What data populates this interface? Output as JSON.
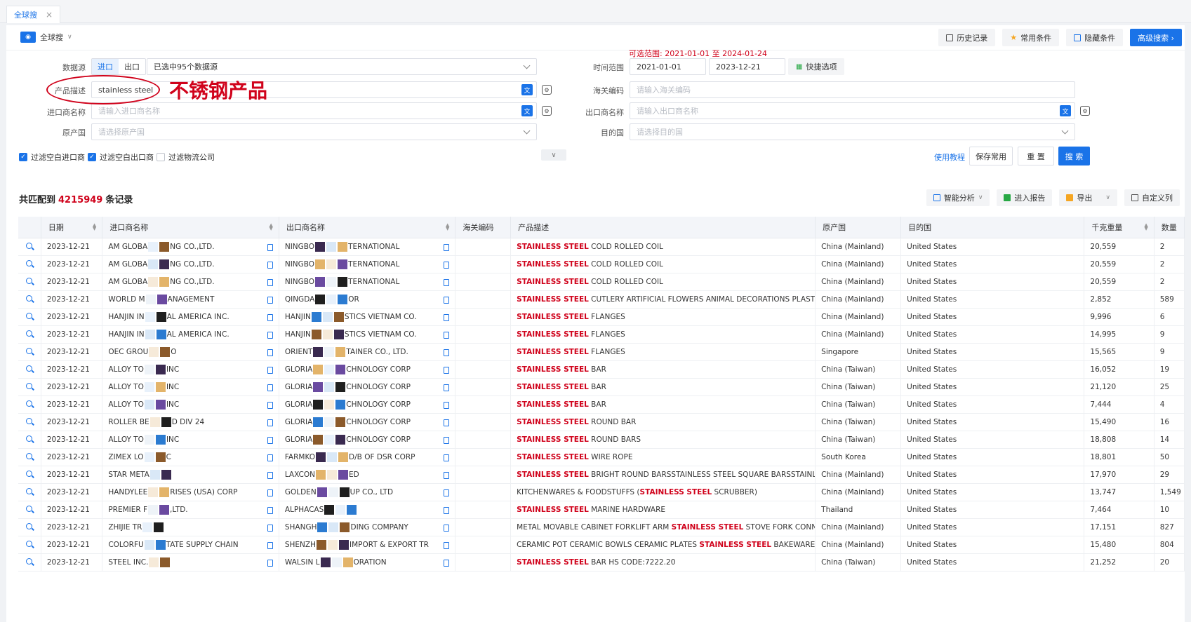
{
  "tab": {
    "label": "全球搜",
    "close": "×"
  },
  "header": {
    "mode_label": "全球搜",
    "buttons": [
      "历史记录",
      "常用条件",
      "隐藏条件",
      "高级搜索 ›"
    ]
  },
  "form": {
    "data_source_label": "数据源",
    "import_label": "进口",
    "export_label": "出口",
    "data_source_value": "已选中95个数据源",
    "product_label": "产品描述",
    "product_value": "stainless steel",
    "importer_label": "进口商名称",
    "importer_placeholder": "请输入进口商名称",
    "origin_label": "原产国",
    "origin_placeholder": "请选择原产国",
    "range_hint": "可选范围: 2021-01-01 至 2024-01-24",
    "time_label": "时间范围",
    "date_start": "2021-01-01",
    "date_end": "2023-12-21",
    "quick_label": "快捷选项",
    "hs_label": "海关编码",
    "hs_placeholder": "请输入海关编码",
    "exporter_label": "出口商名称",
    "exporter_placeholder": "请输入出口商名称",
    "dest_label": "目的国",
    "dest_placeholder": "请选择目的国",
    "filter_importer": "过滤空白进口商",
    "filter_exporter": "过滤空白出口商",
    "filter_logistics": "过滤物流公司",
    "tutorial_link": "使用教程",
    "save_common": "保存常用",
    "reset": "重 置",
    "search": "搜 索"
  },
  "annotation": "不锈钢产品",
  "results": {
    "count_prefix": "共匹配到",
    "count": "4215949",
    "count_suffix": "条记录",
    "tools": [
      "智能分析",
      "进入报告",
      "导出",
      "自定义列"
    ],
    "columns": [
      "日期",
      "进口商名称",
      "出口商名称",
      "海关编码",
      "产品描述",
      "原产国",
      "目的国",
      "千克重量",
      "数量"
    ],
    "rows": [
      {
        "date": "2023-12-21",
        "importer_a": "AM GLOBA",
        "importer_b": "NG CO.,LTD.",
        "exporter_a": "NINGBO",
        "exporter_b": "TERNATIONAL",
        "hl_pre": "",
        "hl": "STAINLESS STEEL",
        "desc": " COLD ROLLED COIL",
        "origin": "China (Mainland)",
        "dest": "United States",
        "kg": "20,559",
        "qty": "2"
      },
      {
        "date": "2023-12-21",
        "importer_a": "AM GLOBA",
        "importer_b": "NG CO.,LTD.",
        "exporter_a": "NINGBO",
        "exporter_b": "TERNATIONAL",
        "hl_pre": "",
        "hl": "STAINLESS STEEL",
        "desc": " COLD ROLLED COIL",
        "origin": "China (Mainland)",
        "dest": "United States",
        "kg": "20,559",
        "qty": "2"
      },
      {
        "date": "2023-12-21",
        "importer_a": "AM GLOBA",
        "importer_b": "NG CO.,LTD.",
        "exporter_a": "NINGBO",
        "exporter_b": "TERNATIONAL",
        "hl_pre": "",
        "hl": "STAINLESS STEEL",
        "desc": " COLD ROLLED COIL",
        "origin": "China (Mainland)",
        "dest": "United States",
        "kg": "20,559",
        "qty": "2"
      },
      {
        "date": "2023-12-21",
        "importer_a": "WORLD M",
        "importer_b": "ANAGEMENT",
        "exporter_a": "QINGDA",
        "exporter_b": "OR",
        "hl_pre": "",
        "hl": "STAINLESS STEEL",
        "desc": " CUTLERY ARTIFICIAL FLOWERS ANIMAL DECORATIONS PLASTIC",
        "origin": "China (Mainland)",
        "dest": "United States",
        "kg": "2,852",
        "qty": "589"
      },
      {
        "date": "2023-12-21",
        "importer_a": "HANJIN IN",
        "importer_b": "AL AMERICA INC.",
        "exporter_a": "HANJIN",
        "exporter_b": "STICS VIETNAM CO.",
        "hl_pre": "",
        "hl": "STAINLESS STEEL",
        "desc": " FLANGES",
        "origin": "China (Mainland)",
        "dest": "United States",
        "kg": "9,996",
        "qty": "6"
      },
      {
        "date": "2023-12-21",
        "importer_a": "HANJIN IN",
        "importer_b": "AL AMERICA INC.",
        "exporter_a": "HANJIN",
        "exporter_b": "STICS VIETNAM CO.",
        "hl_pre": "",
        "hl": "STAINLESS STEEL",
        "desc": " FLANGES",
        "origin": "China (Mainland)",
        "dest": "United States",
        "kg": "14,995",
        "qty": "9"
      },
      {
        "date": "2023-12-21",
        "importer_a": "OEC GROU",
        "importer_b": "O",
        "exporter_a": "ORIENT",
        "exporter_b": "TAINER CO., LTD.",
        "hl_pre": "",
        "hl": "STAINLESS STEEL",
        "desc": " FLANGES",
        "origin": "Singapore",
        "dest": "United States",
        "kg": "15,565",
        "qty": "9"
      },
      {
        "date": "2023-12-21",
        "importer_a": "ALLOY TO",
        "importer_b": "INC",
        "exporter_a": "GLORIA",
        "exporter_b": "CHNOLOGY CORP",
        "hl_pre": "",
        "hl": "STAINLESS STEEL",
        "desc": " BAR",
        "origin": "China (Taiwan)",
        "dest": "United States",
        "kg": "16,052",
        "qty": "19"
      },
      {
        "date": "2023-12-21",
        "importer_a": "ALLOY TO",
        "importer_b": "INC",
        "exporter_a": "GLORIA",
        "exporter_b": "CHNOLOGY CORP",
        "hl_pre": "",
        "hl": "STAINLESS STEEL",
        "desc": " BAR",
        "origin": "China (Taiwan)",
        "dest": "United States",
        "kg": "21,120",
        "qty": "25"
      },
      {
        "date": "2023-12-21",
        "importer_a": "ALLOY TO",
        "importer_b": "INC",
        "exporter_a": "GLORIA",
        "exporter_b": "CHNOLOGY CORP",
        "hl_pre": "",
        "hl": "STAINLESS STEEL",
        "desc": " BAR",
        "origin": "China (Taiwan)",
        "dest": "United States",
        "kg": "7,444",
        "qty": "4"
      },
      {
        "date": "2023-12-21",
        "importer_a": "ROLLER BE",
        "importer_b": "D DIV 24",
        "exporter_a": "GLORIA",
        "exporter_b": "CHNOLOGY CORP",
        "hl_pre": "",
        "hl": "STAINLESS STEEL",
        "desc": " ROUND BAR",
        "origin": "China (Taiwan)",
        "dest": "United States",
        "kg": "15,490",
        "qty": "16"
      },
      {
        "date": "2023-12-21",
        "importer_a": "ALLOY TO",
        "importer_b": "INC",
        "exporter_a": "GLORIA",
        "exporter_b": "CHNOLOGY CORP",
        "hl_pre": "",
        "hl": "STAINLESS STEEL",
        "desc": " ROUND BARS",
        "origin": "China (Taiwan)",
        "dest": "United States",
        "kg": "18,808",
        "qty": "14"
      },
      {
        "date": "2023-12-21",
        "importer_a": "ZIMEX LO",
        "importer_b": "C",
        "exporter_a": "FARMKO",
        "exporter_b": "D/B OF DSR CORP",
        "hl_pre": "",
        "hl": "STAINLESS STEEL",
        "desc": " WIRE ROPE",
        "origin": "South Korea",
        "dest": "United States",
        "kg": "18,801",
        "qty": "50"
      },
      {
        "date": "2023-12-21",
        "importer_a": "STAR META",
        "importer_b": "",
        "exporter_a": "LAXCON",
        "exporter_b": "ED",
        "hl_pre": "",
        "hl": "STAINLESS STEEL",
        "desc": " BRIGHT ROUND BARSSTAINLESS STEEL SQUARE BARSSTAINLESS",
        "origin": "China (Mainland)",
        "dest": "United States",
        "kg": "17,970",
        "qty": "29"
      },
      {
        "date": "2023-12-21",
        "importer_a": "HANDYLEE",
        "importer_b": "RISES (USA) CORP",
        "exporter_a": "GOLDEN",
        "exporter_b": "UP CO., LTD",
        "hl_pre": "KITCHENWARES & FOODSTUFFS (",
        "hl": "STAINLESS STEEL",
        "desc": " SCRUBBER)",
        "origin": "China (Mainland)",
        "dest": "United States",
        "kg": "13,747",
        "qty": "1,549"
      },
      {
        "date": "2023-12-21",
        "importer_a": "PREMIER F",
        "importer_b": ",LTD.",
        "exporter_a": "ALPHACAS",
        "exporter_b": "",
        "hl_pre": "",
        "hl": "STAINLESS STEEL",
        "desc": " MARINE HARDWARE",
        "origin": "Thailand",
        "dest": "United States",
        "kg": "7,464",
        "qty": "10"
      },
      {
        "date": "2023-12-21",
        "importer_a": "ZHIJIE TR",
        "importer_b": "",
        "exporter_a": "SHANGH",
        "exporter_b": "DING COMPANY",
        "hl_pre": "METAL MOVABLE CABINET FORKLIFT ARM ",
        "hl": "STAINLESS STEEL",
        "desc": " STOVE FORK CONNEC",
        "origin": "China (Mainland)",
        "dest": "United States",
        "kg": "17,151",
        "qty": "827"
      },
      {
        "date": "2023-12-21",
        "importer_a": "COLORFU",
        "importer_b": "TATE SUPPLY CHAIN",
        "exporter_a": "SHENZH",
        "exporter_b": "IMPORT & EXPORT TR",
        "hl_pre": "CERAMIC POT CERAMIC BOWLS CERAMIC PLATES ",
        "hl": "STAINLESS STEEL",
        "desc": " BAKEWARE KI",
        "origin": "China (Mainland)",
        "dest": "United States",
        "kg": "15,480",
        "qty": "804"
      },
      {
        "date": "2023-12-21",
        "importer_a": "STEEL INC.",
        "importer_b": "",
        "exporter_a": "WALSIN L",
        "exporter_b": "ORATION",
        "hl_pre": "",
        "hl": "STAINLESS STEEL",
        "desc": " BAR HS CODE:7222.20",
        "origin": "China (Taiwan)",
        "dest": "United States",
        "kg": "21,252",
        "qty": "20"
      }
    ]
  }
}
